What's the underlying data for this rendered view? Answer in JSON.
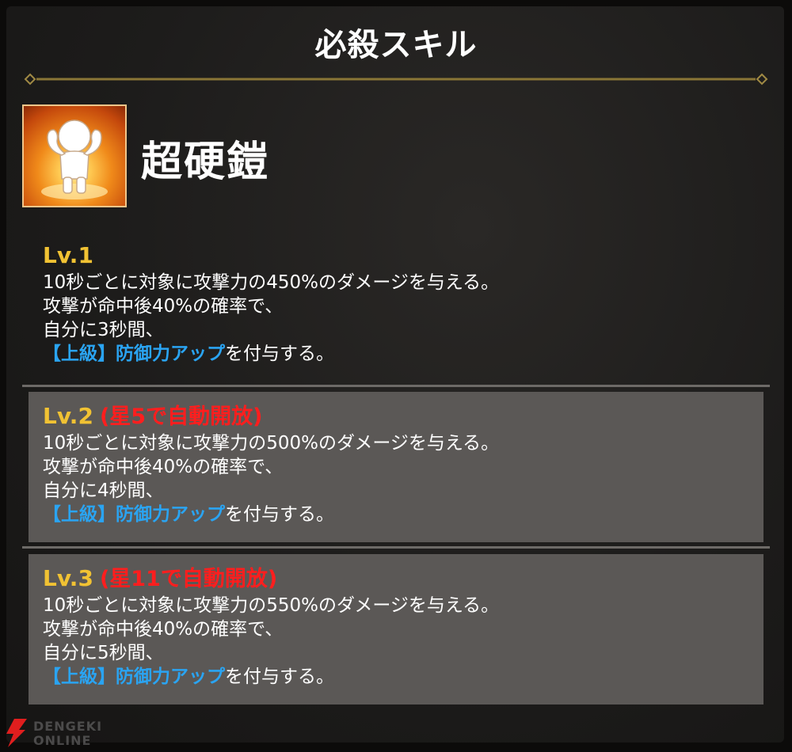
{
  "panel": {
    "title": "必殺スキル"
  },
  "skill": {
    "name": "超硬鎧",
    "icon": "flexing-character-icon"
  },
  "levels": [
    {
      "label": "Lv.1",
      "unlock": "",
      "line1": "10秒ごとに対象に攻撃力の450%のダメージを与える。",
      "line2": "攻撃が命中後40%の確率で、",
      "line3": "自分に3秒間、",
      "buff": "【上級】防御力アップ",
      "line4_suffix": "を付与する。"
    },
    {
      "label": "Lv.2",
      "unlock": "(星5で自動開放)",
      "line1": "10秒ごとに対象に攻撃力の500%のダメージを与える。",
      "line2": "攻撃が命中後40%の確率で、",
      "line3": "自分に4秒間、",
      "buff": "【上級】防御力アップ",
      "line4_suffix": "を付与する。"
    },
    {
      "label": "Lv.3",
      "unlock": "(星11で自動開放)",
      "line1": "10秒ごとに対象に攻撃力の550%のダメージを与える。",
      "line2": "攻撃が命中後40%の確率で、",
      "line3": "自分に5秒間、",
      "buff": "【上級】防御力アップ",
      "line4_suffix": "を付与する。"
    }
  ],
  "watermark": {
    "line1": "DENGEKI",
    "line2": "ONLINE"
  },
  "colors": {
    "level_label": "#f1c233",
    "unlock_text": "#ff1e1e",
    "buff_text": "#2aa4f2",
    "shaded_block": "#5b5856"
  }
}
